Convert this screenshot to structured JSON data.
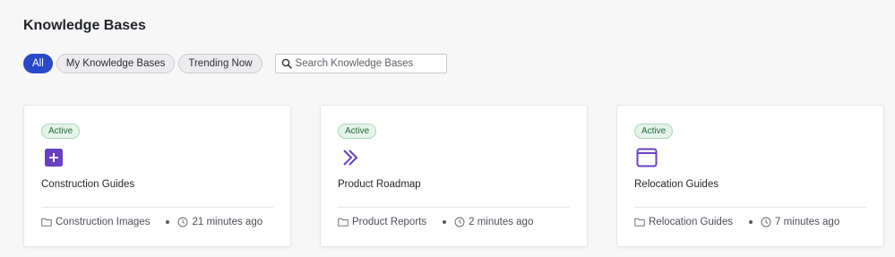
{
  "page": {
    "title": "Knowledge Bases"
  },
  "filters": [
    {
      "label": "All",
      "active": true
    },
    {
      "label": "My Knowledge Bases",
      "active": false
    },
    {
      "label": "Trending Now",
      "active": false
    }
  ],
  "search": {
    "placeholder": "Search Knowledge Bases",
    "value": ""
  },
  "colors": {
    "accent": "#2a49c9",
    "icon_purple": "#6a3fc4",
    "active_badge": "#1d6a37"
  },
  "cards": [
    {
      "status": "Active",
      "icon": "plus-square-icon",
      "name": "Construction Guides",
      "folder": "Construction Images",
      "updated": "21 minutes ago"
    },
    {
      "status": "Active",
      "icon": "double-chevron-right-icon",
      "name": "Product Roadmap",
      "folder": "Product Reports",
      "updated": "2 minutes ago"
    },
    {
      "status": "Active",
      "icon": "browser-window-icon",
      "name": "Relocation Guides",
      "folder": "Relocation Guides",
      "updated": "7 minutes ago"
    }
  ]
}
